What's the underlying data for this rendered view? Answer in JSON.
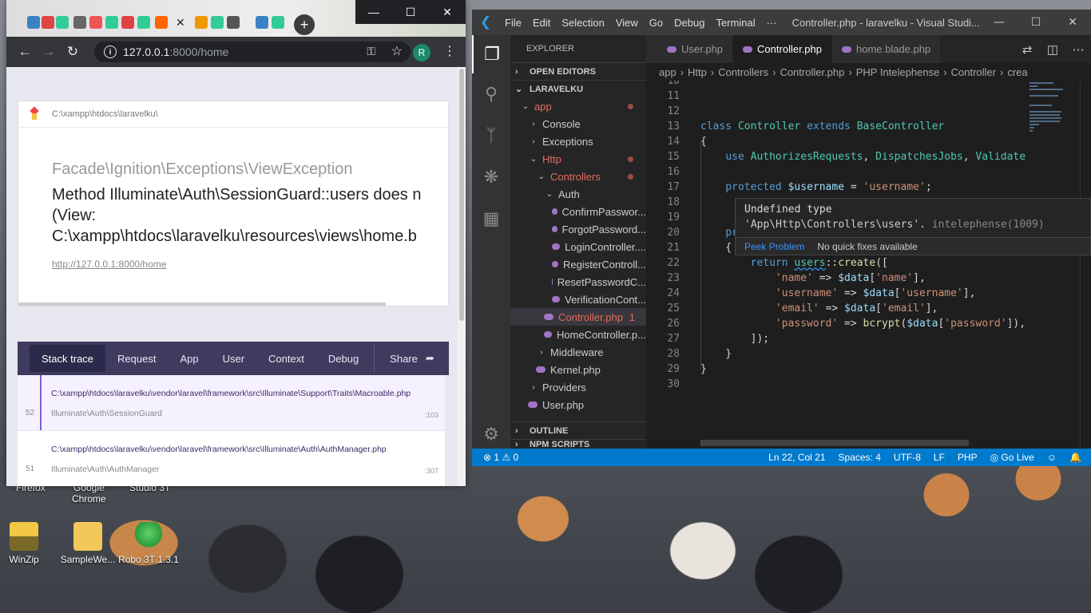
{
  "desktop": {
    "top_labels": [
      "Firefox",
      "Google",
      "Chrome",
      "Studio 3T"
    ],
    "icons": [
      {
        "label": "WinZip",
        "icon": "winzip-icon"
      },
      {
        "label": "SampleWe...",
        "icon": "folder-icon"
      },
      {
        "label": "Robo 3T 1.3.1",
        "icon": "robo3t-icon"
      }
    ]
  },
  "browser": {
    "win_controls": {
      "minimize": "—",
      "maximize": "☐",
      "close": "✕"
    },
    "tab_close": "✕",
    "new_tab": "+",
    "nav": {
      "back": "←",
      "forward": "→",
      "reload": "↻",
      "info": "i",
      "key": "⚿",
      "star": "☆",
      "menu": "⋮"
    },
    "url_host": "127.0.0.1",
    "url_path": ":8000/home",
    "avatar_letter": "R",
    "error": {
      "file_path": "C:\\xampp\\htdocs\\laravelku\\",
      "exception_class": "Facade\\Ignition\\Exceptions\\ViewException",
      "message": "Method Illuminate\\Auth\\SessionGuard::users does n\n(View:\nC:\\xampp\\htdocs\\laravelku\\resources\\views\\home.b",
      "url": "http://127.0.0.1:8000/home"
    },
    "tabs": [
      "Stack trace",
      "Request",
      "App",
      "User",
      "Context",
      "Debug"
    ],
    "share": "Share",
    "frames": [
      {
        "num": "52",
        "file": "C:\\xampp\\htdocs\\laravelku\\vendor\\laravel\\framework\\src\\Illuminate\\Support\\Traits\\Macroable.php",
        "cls": "Illuminate\\Auth\\SessionGuard",
        "line": ":103"
      },
      {
        "num": "51",
        "file": "C:\\xampp\\htdocs\\laravelku\\vendor\\laravel\\framework\\src\\Illuminate\\Auth\\AuthManager.php",
        "cls": "Illuminate\\Auth\\AuthManager",
        "line": ":307"
      }
    ]
  },
  "vscode": {
    "menu": [
      "File",
      "Edit",
      "Selection",
      "View",
      "Go",
      "Debug",
      "Terminal",
      "···"
    ],
    "title": "Controller.php - laravelku - Visual Studi...",
    "win_controls": {
      "minimize": "—",
      "maximize": "☐",
      "close": "✕"
    },
    "explorer_header": "EXPLORER",
    "sections": {
      "open_editors": "OPEN EDITORS",
      "project": "LARAVELKU",
      "outline": "OUTLINE",
      "npm": "NPM SCRIPTS"
    },
    "tree": [
      {
        "label": "app",
        "chev": "v",
        "indent": 1,
        "mod": true,
        "dot": true
      },
      {
        "label": "Console",
        "chev": ">",
        "indent": 2
      },
      {
        "label": "Exceptions",
        "chev": ">",
        "indent": 2
      },
      {
        "label": "Http",
        "chev": "v",
        "indent": 2,
        "mod": true,
        "dot": true
      },
      {
        "label": "Controllers",
        "chev": "v",
        "indent": 3,
        "mod": true,
        "dot": true
      },
      {
        "label": "Auth",
        "chev": "v",
        "indent": 4
      },
      {
        "label": "ConfirmPasswor...",
        "php": true,
        "indent": 5
      },
      {
        "label": "ForgotPassword...",
        "php": true,
        "indent": 5
      },
      {
        "label": "LoginController....",
        "php": true,
        "indent": 5
      },
      {
        "label": "RegisterControll...",
        "php": true,
        "indent": 5
      },
      {
        "label": "ResetPasswordC...",
        "php": true,
        "indent": 5
      },
      {
        "label": "VerificationCont...",
        "php": true,
        "indent": 5
      },
      {
        "label": "Controller.php",
        "php": true,
        "indent": 4,
        "mod": true,
        "sel": true,
        "badge": "1"
      },
      {
        "label": "HomeController.p...",
        "php": true,
        "indent": 4
      },
      {
        "label": "Middleware",
        "chev": ">",
        "indent": 3
      },
      {
        "label": "Kernel.php",
        "php": true,
        "indent": 3
      },
      {
        "label": "Providers",
        "chev": ">",
        "indent": 2
      },
      {
        "label": "User.php",
        "php": true,
        "indent": 2
      }
    ],
    "editor_tabs": [
      {
        "label": "User.php",
        "active": false
      },
      {
        "label": "Controller.php",
        "active": true
      },
      {
        "label": "home.blade.php",
        "active": false
      }
    ],
    "breadcrumbs": [
      "app",
      "Http",
      "Controllers",
      "Controller.php",
      "PHP Intelephense",
      "Controller",
      "crea"
    ],
    "code": [
      {
        "n": "10",
        "parts": []
      },
      {
        "n": "11",
        "parts": []
      },
      {
        "n": "12",
        "parts": []
      },
      {
        "n": "13",
        "parts": [
          [
            "kw",
            "class "
          ],
          [
            "ty",
            "Controller "
          ],
          [
            "kw",
            "extends "
          ],
          [
            "ty",
            "BaseController"
          ]
        ]
      },
      {
        "n": "14",
        "parts": [
          [
            "pl",
            "{"
          ]
        ]
      },
      {
        "n": "15",
        "parts": [
          [
            "pl",
            "    "
          ],
          [
            "kw",
            "use "
          ],
          [
            "ty",
            "AuthorizesRequests"
          ],
          [
            "pl",
            ", "
          ],
          [
            "ty",
            "DispatchesJobs"
          ],
          [
            "pl",
            ", "
          ],
          [
            "ty",
            "Validates"
          ]
        ]
      },
      {
        "n": "16",
        "parts": []
      },
      {
        "n": "17",
        "parts": [
          [
            "pl",
            "    "
          ],
          [
            "kw",
            "protected "
          ],
          [
            "var",
            "$username"
          ],
          [
            "pl",
            " = "
          ],
          [
            "str",
            "'username'"
          ],
          [
            "pl",
            ";"
          ]
        ]
      },
      {
        "n": "18",
        "parts": []
      },
      {
        "n": "19",
        "parts": []
      },
      {
        "n": "20",
        "parts": [
          [
            "pl",
            "    "
          ],
          [
            "kw",
            "pr"
          ]
        ]
      },
      {
        "n": "21",
        "parts": [
          [
            "pl",
            "    {"
          ]
        ]
      },
      {
        "n": "22",
        "parts": [
          [
            "pl",
            "        "
          ],
          [
            "kw",
            "return "
          ],
          [
            "ty squiggle",
            "users"
          ],
          [
            "pl",
            "::"
          ],
          [
            "fn",
            "create"
          ],
          [
            "pl",
            "(["
          ]
        ]
      },
      {
        "n": "23",
        "parts": [
          [
            "pl",
            "            "
          ],
          [
            "str",
            "'name'"
          ],
          [
            "pl",
            " => "
          ],
          [
            "var",
            "$data"
          ],
          [
            "pl",
            "["
          ],
          [
            "str",
            "'name'"
          ],
          [
            "pl",
            "],"
          ]
        ]
      },
      {
        "n": "24",
        "parts": [
          [
            "pl",
            "            "
          ],
          [
            "str",
            "'username'"
          ],
          [
            "pl",
            " => "
          ],
          [
            "var",
            "$data"
          ],
          [
            "pl",
            "["
          ],
          [
            "str",
            "'username'"
          ],
          [
            "pl",
            "],"
          ]
        ]
      },
      {
        "n": "25",
        "parts": [
          [
            "pl",
            "            "
          ],
          [
            "str",
            "'email'"
          ],
          [
            "pl",
            " => "
          ],
          [
            "var",
            "$data"
          ],
          [
            "pl",
            "["
          ],
          [
            "str",
            "'email'"
          ],
          [
            "pl",
            "],"
          ]
        ]
      },
      {
        "n": "26",
        "parts": [
          [
            "pl",
            "            "
          ],
          [
            "str",
            "'password'"
          ],
          [
            "pl",
            " => "
          ],
          [
            "fn",
            "bcrypt"
          ],
          [
            "pl",
            "("
          ],
          [
            "var",
            "$data"
          ],
          [
            "pl",
            "["
          ],
          [
            "str",
            "'password'"
          ],
          [
            "pl",
            "]),"
          ]
        ]
      },
      {
        "n": "27",
        "parts": [
          [
            "pl",
            "        ]);"
          ]
        ]
      },
      {
        "n": "28",
        "parts": [
          [
            "pl",
            "    }"
          ]
        ]
      },
      {
        "n": "29",
        "parts": [
          [
            "pl",
            "}"
          ]
        ]
      },
      {
        "n": "30",
        "parts": []
      }
    ],
    "hover": {
      "title": "Undefined type",
      "detail": "'App\\Http\\Controllers\\users'.",
      "source": " intelephense(1009)",
      "peek": "Peek Problem",
      "no_fixes": "No quick fixes available"
    },
    "status": {
      "errors": "⊗ 1 ⚠ 0",
      "position": "Ln 22, Col 21",
      "spaces": "Spaces: 4",
      "encoding": "UTF-8",
      "eol": "LF",
      "language": "PHP",
      "golive": "Go Live",
      "feedback": "☺",
      "bell": "🔔"
    }
  }
}
